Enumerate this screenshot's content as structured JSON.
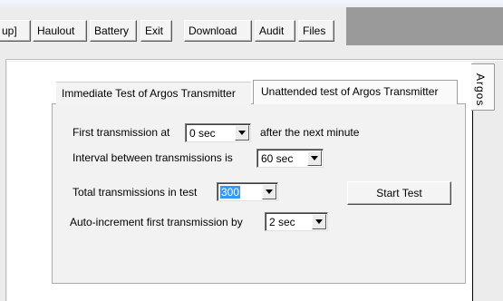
{
  "toolbar": {
    "buttons": [
      "up]",
      "Haulout",
      "Battery",
      "Exit",
      "Download",
      "Audit",
      "Files"
    ]
  },
  "side_tab": {
    "label": "Argos"
  },
  "tabs": {
    "immediate": "Immediate Test of Argos Transmitter",
    "unattended": "Unattended test of Argos Transmitter"
  },
  "form": {
    "first_tx_label": "First transmission at",
    "first_tx_value": "0 sec",
    "first_tx_suffix": "after the next minute",
    "interval_label": "Interval between transmissions is",
    "interval_value": "60 sec",
    "total_label": "Total transmissions in test",
    "total_value": "300",
    "autoinc_label": "Auto-increment first transmission by",
    "autoinc_value": "2 sec",
    "start_button": "Start Test"
  }
}
